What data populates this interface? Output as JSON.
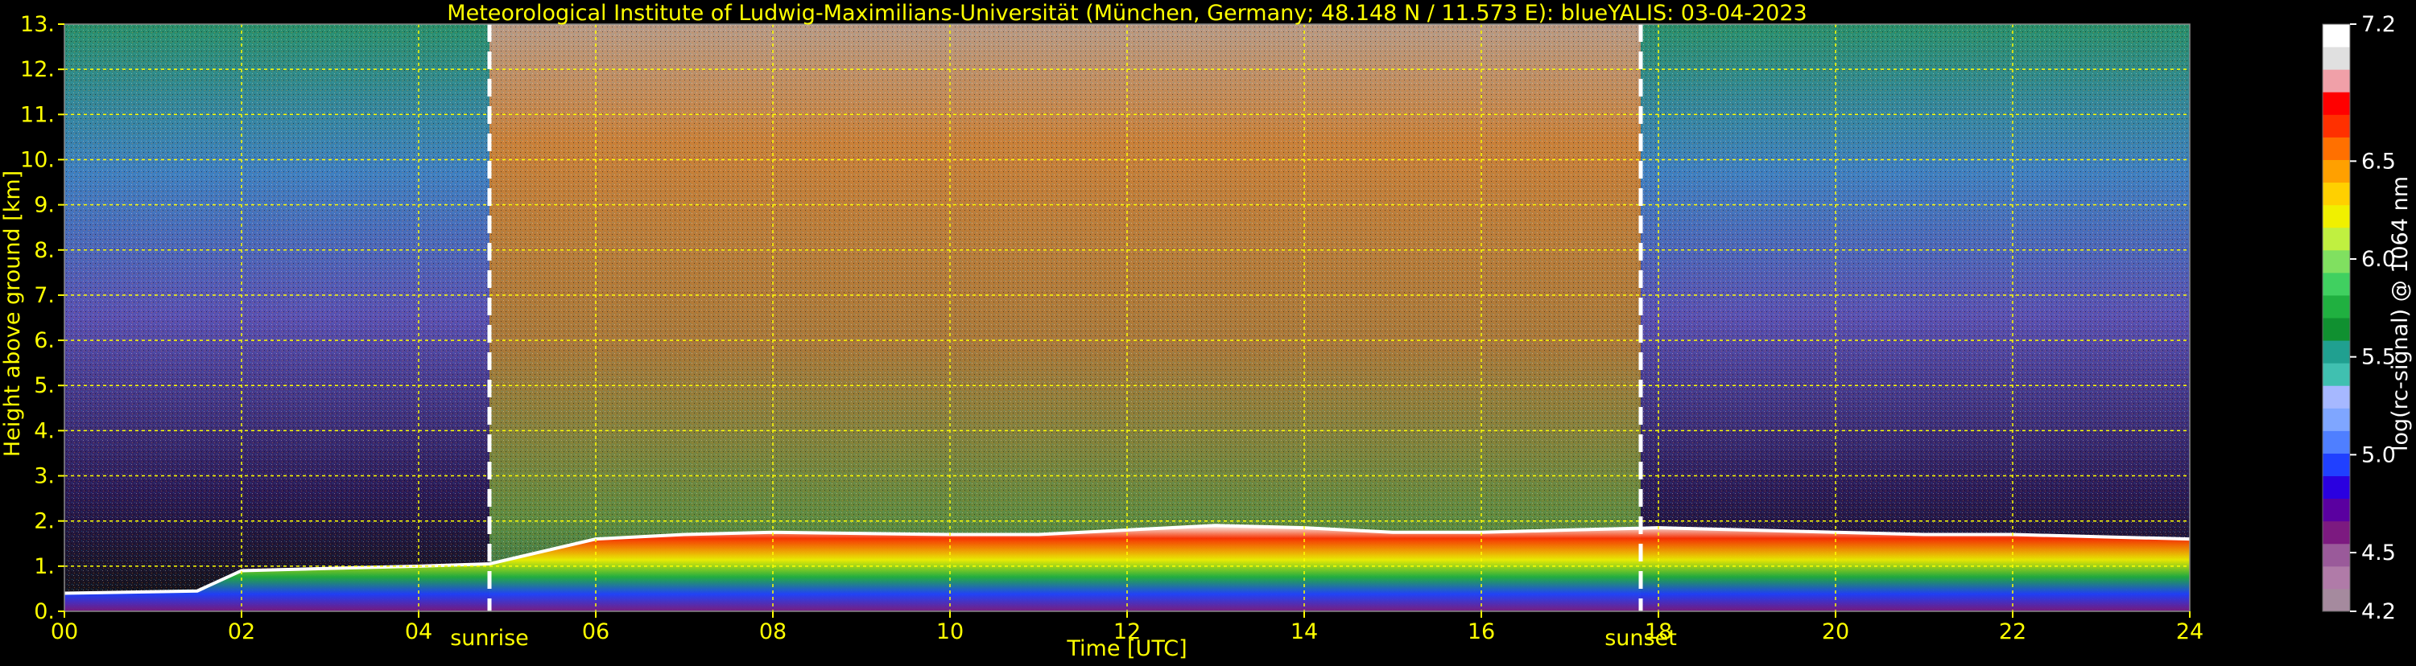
{
  "chart_data": {
    "type": "heatmap",
    "title": "Meteorological Institute of Ludwig-Maximilians-Universität (München, Germany; 48.148 N / 11.573 E):    blueYALIS: 03-04-2023",
    "xlabel": "Time [UTC]",
    "ylabel": "Height above ground [km]",
    "xlim": [
      0,
      24
    ],
    "ylim": [
      0,
      13
    ],
    "x_ticks": [
      "00",
      "02",
      "04",
      "06",
      "08",
      "10",
      "12",
      "14",
      "16",
      "18",
      "20",
      "22",
      "24"
    ],
    "y_ticks": [
      "0.",
      "1.",
      "2.",
      "3.",
      "4.",
      "5.",
      "6.",
      "7.",
      "8.",
      "9.",
      "10.",
      "11.",
      "12.",
      "13."
    ],
    "grid": true,
    "grid_color": "#ffff00",
    "colorbar": {
      "label": "log(rc-signal) @ 1064 nm",
      "min": 4.2,
      "max": 7.2,
      "ticks": [
        "4.2",
        "4.5",
        "5.0",
        "5.5",
        "6.0",
        "6.5",
        "7.2"
      ],
      "tick_values": [
        4.2,
        4.5,
        5.0,
        5.5,
        6.0,
        6.5,
        7.2
      ],
      "colors": [
        "#a58a9e",
        "#b07ba8",
        "#9a5a9a",
        "#7c1a80",
        "#5a00a0",
        "#2a00e0",
        "#2040ff",
        "#4f7fff",
        "#7fa6ff",
        "#a6b8ff",
        "#40c0b0",
        "#20a090",
        "#109030",
        "#20b040",
        "#40d060",
        "#80e060",
        "#c0f040",
        "#f0f000",
        "#ffd000",
        "#ffa000",
        "#ff7000",
        "#ff3000",
        "#ff0000",
        "#f0a0a8",
        "#e0e0e0",
        "#ffffff"
      ]
    },
    "annotations": [
      {
        "text": "sunrise",
        "x": 4.8
      },
      {
        "text": "sunset",
        "x": 17.8
      }
    ],
    "boundary_layer_top_km": {
      "x": [
        0,
        1.5,
        2,
        3,
        4,
        4.8,
        6,
        7,
        8,
        10,
        11,
        12,
        13,
        14,
        15,
        16,
        17,
        18,
        19,
        20,
        21,
        22,
        23,
        24
      ],
      "y": [
        0.4,
        0.45,
        0.9,
        0.95,
        1.0,
        1.05,
        1.6,
        1.7,
        1.75,
        1.7,
        1.7,
        1.8,
        1.9,
        1.85,
        1.75,
        1.75,
        1.8,
        1.85,
        1.8,
        1.75,
        1.7,
        1.7,
        1.65,
        1.6
      ]
    }
  },
  "colors": {
    "text": "#ffff00",
    "title": "#ffff00",
    "annotation": "#ffff00",
    "background": "#000000"
  }
}
